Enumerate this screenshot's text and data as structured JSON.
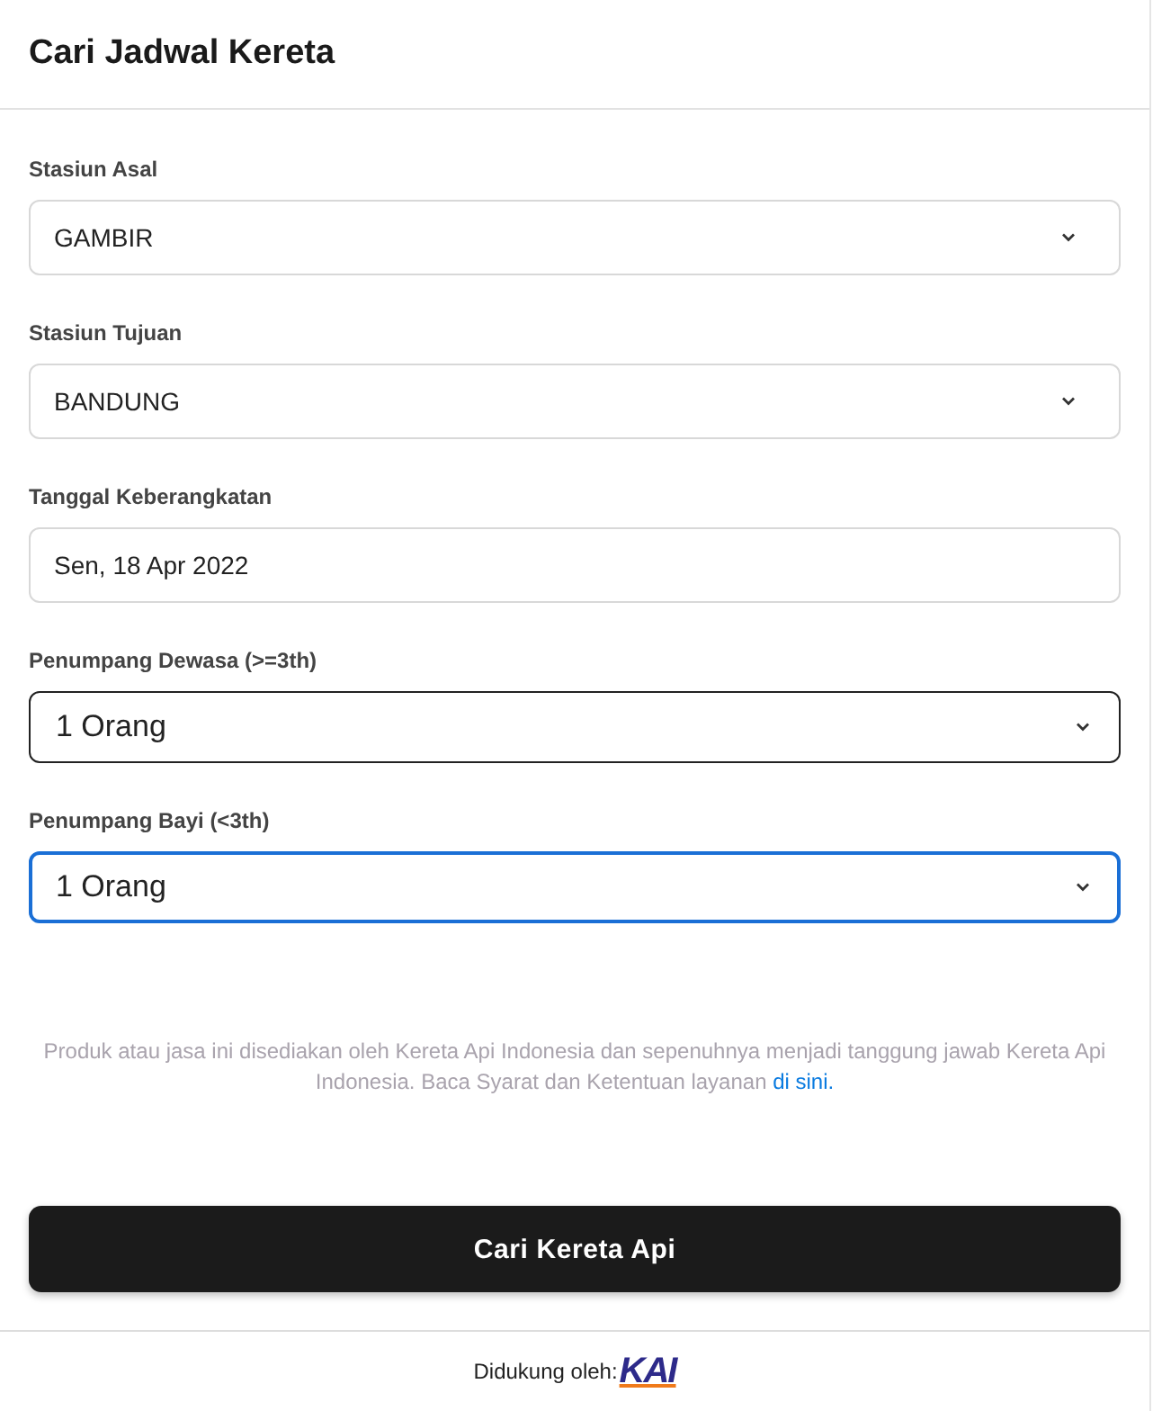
{
  "header": {
    "title": "Cari Jadwal Kereta"
  },
  "fields": [
    {
      "label": "Stasiun Asal",
      "value": "GAMBIR",
      "kind": "select",
      "focused": false
    },
    {
      "label": "Stasiun Tujuan",
      "value": "BANDUNG",
      "kind": "select",
      "focused": false
    },
    {
      "label": "Tanggal Keberangkatan",
      "value": "Sen, 18 Apr 2022",
      "kind": "date",
      "focused": false
    },
    {
      "label": "Penumpang Dewasa (>=3th)",
      "value": "1 Orang",
      "kind": "native-select",
      "focused": false
    },
    {
      "label": "Penumpang Bayi (<3th)",
      "value": "1 Orang",
      "kind": "native-select",
      "focused": true
    }
  ],
  "disclaimer": {
    "text": "Produk atau jasa ini disediakan oleh Kereta Api Indonesia dan sepenuhnya menjadi tanggung jawab Kereta Api Indonesia. Baca Syarat dan Ketentuan layanan",
    "link": "di sini."
  },
  "submit_button": "Cari Kereta Api",
  "footer": {
    "text": "Didukung oleh:",
    "logo": "KAI"
  }
}
